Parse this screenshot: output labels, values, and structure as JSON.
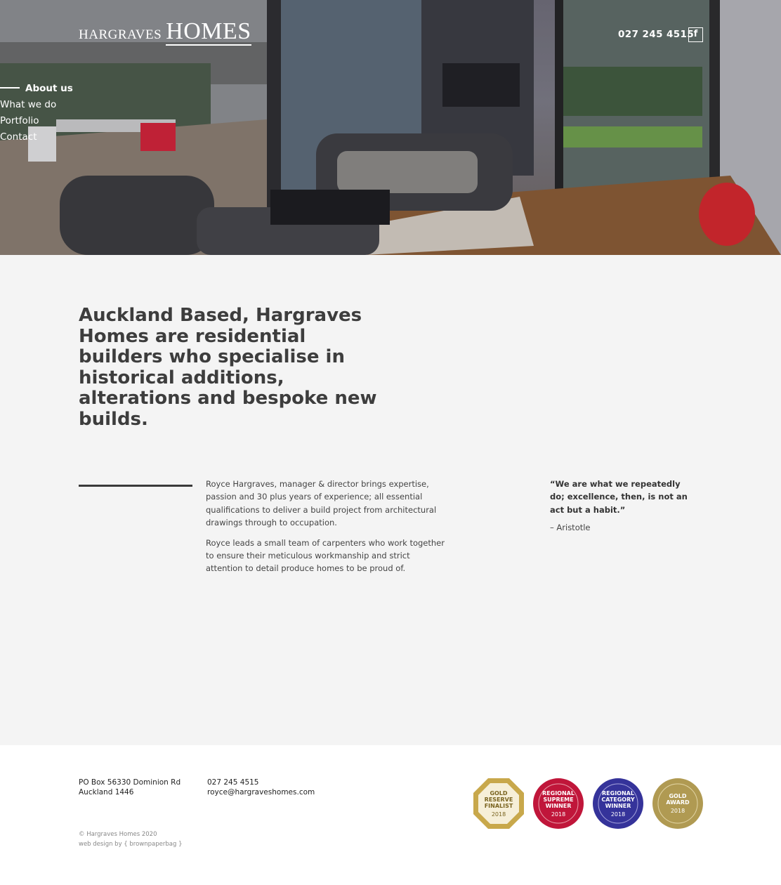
{
  "header": {
    "logo_small": "HARGRAVES",
    "logo_large": "HOMES",
    "phone": "027 245 4515",
    "facebook_glyph": "f"
  },
  "nav": {
    "items": [
      {
        "label": "About us",
        "active": true
      },
      {
        "label": "What we do",
        "active": false
      },
      {
        "label": "Portfolio",
        "active": false
      },
      {
        "label": "Contact",
        "active": false
      }
    ]
  },
  "main": {
    "headline": "Auckland Based, Hargraves Homes are residential builders who specialise in historical additions, alterations and bespoke new builds.",
    "paragraphs": [
      "Royce Hargraves, manager & director brings expertise, passion and 30 plus years of experience; all essential qualifications to deliver a build project from architectural drawings through to occupation.",
      "Royce leads a small team of carpenters who work together to ensure their meticulous workmanship and strict attention to detail produce homes to be proud of."
    ],
    "quote": "“We are what we repeatedly do; excellence, then, is not an act but a habit.”",
    "quote_author": "– Aristotle"
  },
  "footer": {
    "address_line1": "PO Box 56330 Dominion Rd",
    "address_line2": "Auckland 1446",
    "phone": "027 245 4515",
    "email": "royce@hargraveshomes.com",
    "copyright": "© Hargraves Homes 2020",
    "credit": "web design by { brownpaperbag }",
    "badges": [
      {
        "line1": "GOLD",
        "line2": "RESERVE",
        "line3": "FINALIST",
        "year": "2018",
        "color": "#c8a84b"
      },
      {
        "line1": "REGIONAL",
        "line2": "SUPREME",
        "line3": "WINNER",
        "year": "2018",
        "color": "#c0163a"
      },
      {
        "line1": "REGIONAL",
        "line2": "CATEGORY",
        "line3": "WINNER",
        "year": "2018",
        "color": "#35339a"
      },
      {
        "line1": "GOLD",
        "line2": "AWARD",
        "line3": "",
        "year": "2018",
        "color": "#b09a52"
      }
    ]
  },
  "colors": {
    "main_bg": "#f4f4f4",
    "text": "#3d3d3d",
    "hero_overlay": "#6f6d78"
  }
}
